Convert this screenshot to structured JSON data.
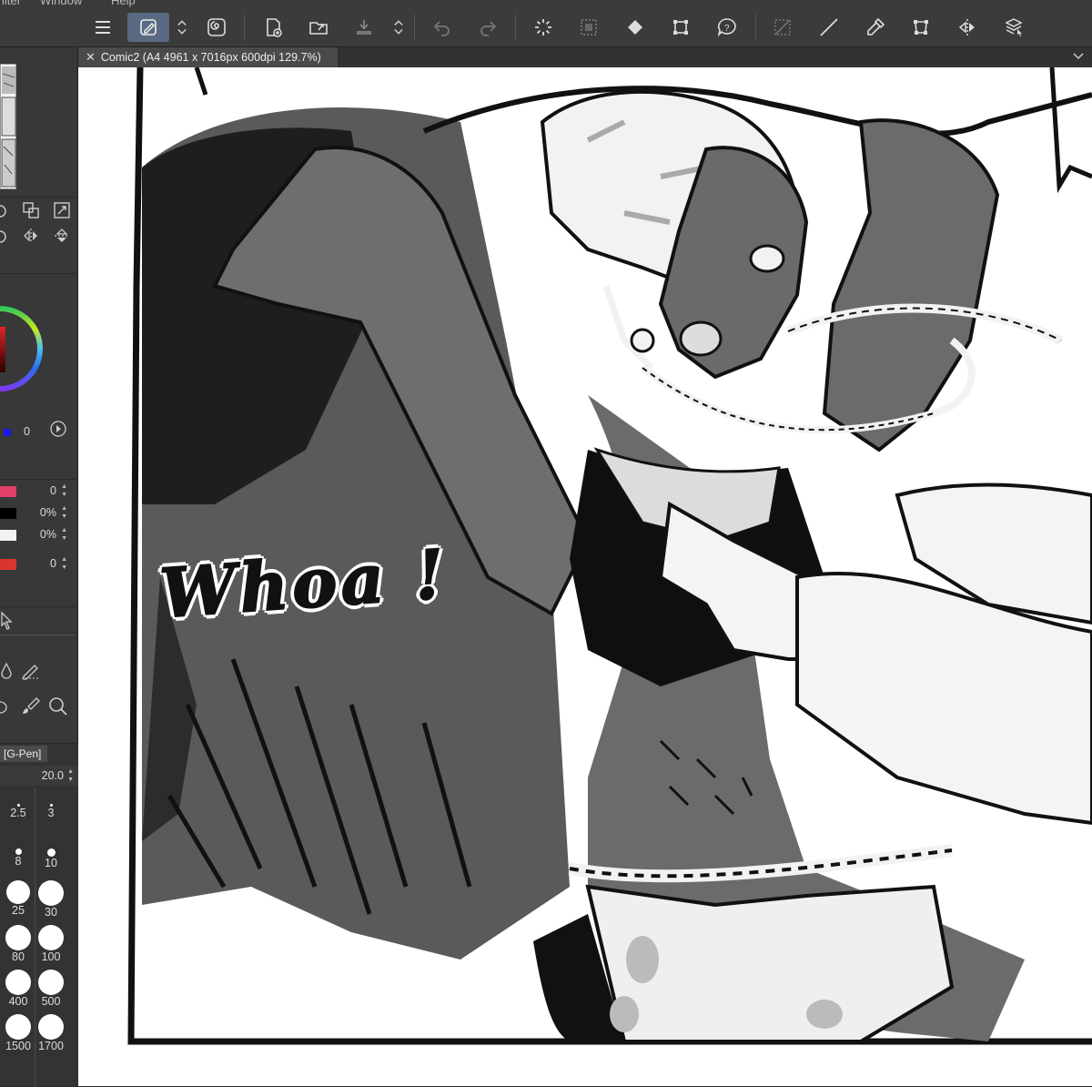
{
  "menu": {
    "items": [
      "ilter",
      "Window",
      "Help"
    ]
  },
  "document_tab": {
    "title": "Comic2 (A4 4961 x 7016px 600dpi 129.7%)"
  },
  "left_panel": {
    "color_sub_value": "0",
    "color_rows": [
      {
        "color": "#e0406a",
        "value": "0"
      },
      {
        "color": "#000000",
        "value": "0%"
      },
      {
        "color": "#f2f2f2",
        "value": "0%"
      },
      {
        "color": "#d8362f",
        "value": "0"
      }
    ],
    "brush_name": "[G-Pen]",
    "brush_size_value": "20.0",
    "brush_sizes": [
      "2.5",
      "3",
      "8",
      "10",
      "25",
      "30",
      "80",
      "100",
      "400",
      "500",
      "1500",
      "1700"
    ]
  },
  "canvas": {
    "speech_text": "Whoa !"
  },
  "colors": {
    "ui_dark": "#3b3b3b",
    "active_tool": "#5a6a82",
    "canvas_bg": "#ffffff"
  },
  "icons": [
    "menu-icon",
    "pen-tool-icon",
    "updown-chevron-icon",
    "spiral-icon",
    "new-canvas-icon",
    "open-folder-icon",
    "save-icon",
    "updown-chevron-icon",
    "undo-icon",
    "redo-icon",
    "loading-icon",
    "select-all-icon",
    "fill-icon",
    "transform-icon",
    "help-icon",
    "deselect-icon",
    "line-icon",
    "eyedropper-icon",
    "crop-icon",
    "flip-icon",
    "layer-select-icon"
  ]
}
